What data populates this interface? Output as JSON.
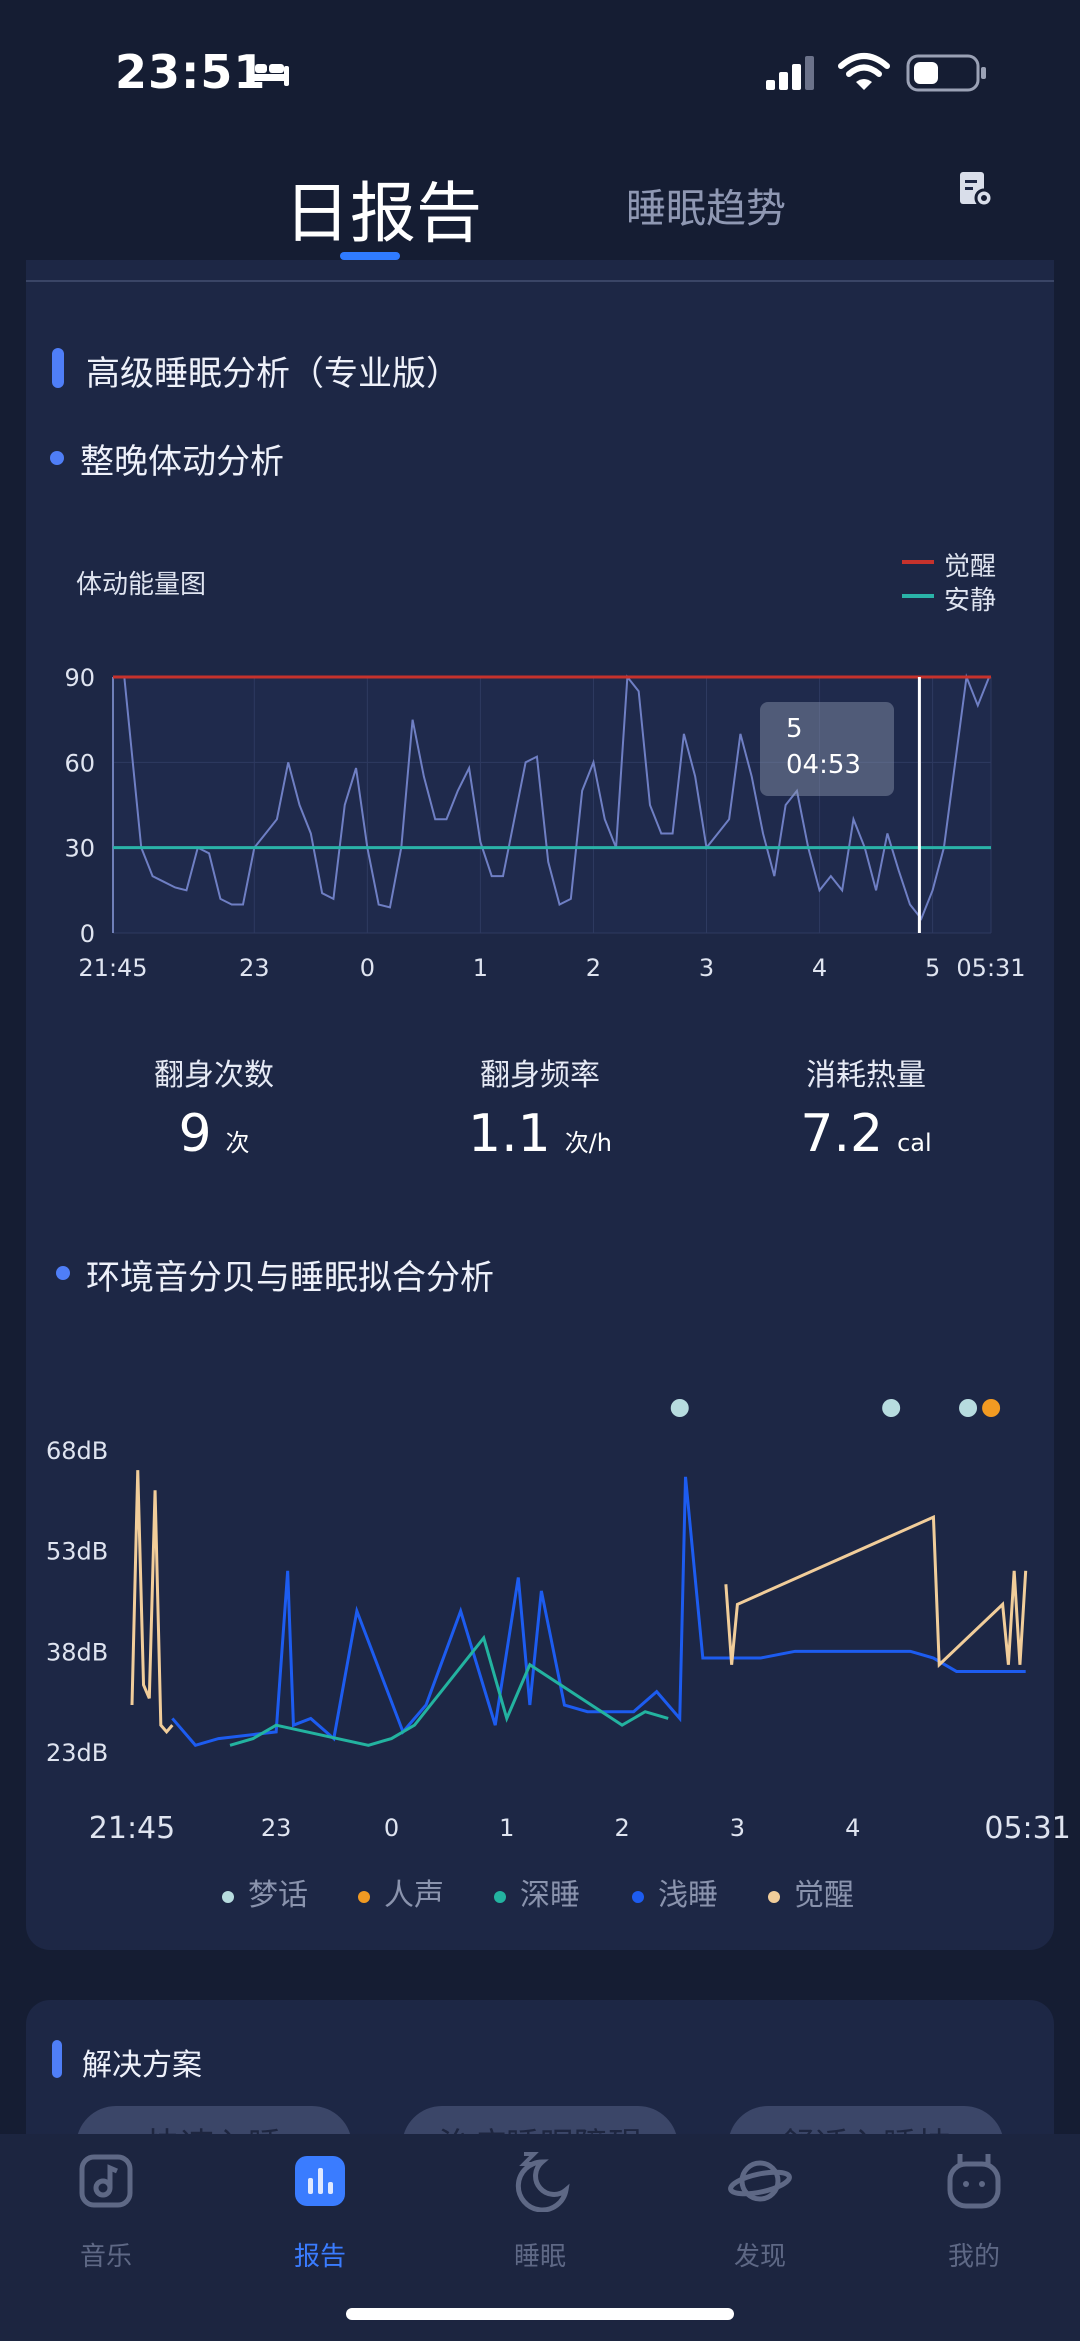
{
  "status_bar": {
    "time": "23:51"
  },
  "tabs": [
    {
      "label": "日报告"
    },
    {
      "label": "睡眠趋势"
    }
  ],
  "advanced": {
    "title": "高级睡眠分析（专业版）",
    "movement": {
      "title": "整晚体动分析",
      "chart_label": "体动能量图",
      "legend": [
        {
          "label": "觉醒",
          "color": "#c6322c"
        },
        {
          "label": "安静",
          "color": "#2ab3a8"
        }
      ],
      "tooltip": {
        "value": "5",
        "time": "04:53"
      }
    },
    "stats": [
      {
        "label": "翻身次数",
        "value": "9",
        "unit": "次"
      },
      {
        "label": "翻身频率",
        "value": "1.1",
        "unit": "次/h"
      },
      {
        "label": "消耗热量",
        "value": "7.2",
        "unit": "cal"
      }
    ],
    "sound": {
      "title": "环境音分贝与睡眠拟合分析",
      "legend": [
        {
          "label": "梦话",
          "color": "#b7dcdf"
        },
        {
          "label": "人声",
          "color": "#f19a22"
        },
        {
          "label": "深睡",
          "color": "#23b3a0"
        },
        {
          "label": "浅睡",
          "color": "#1d5cf0"
        },
        {
          "label": "觉醒",
          "color": "#f1cd9a"
        }
      ]
    }
  },
  "solutions": {
    "title": "解决方案",
    "items": [
      {
        "label": "快速入睡"
      },
      {
        "label": "治疗睡眠障碍"
      },
      {
        "label": "舒适入睡技"
      }
    ]
  },
  "nav": [
    {
      "label": "音乐",
      "icon": "music-icon"
    },
    {
      "label": "报告",
      "icon": "report-icon"
    },
    {
      "label": "睡眠",
      "icon": "sleep-moon-icon"
    },
    {
      "label": "发现",
      "icon": "planet-icon"
    },
    {
      "label": "我的",
      "icon": "profile-icon"
    }
  ],
  "colors": {
    "accent": "#2f7bff",
    "background": "#151d33",
    "card": "#1d2745"
  },
  "chart_data": [
    {
      "type": "line",
      "title": "体动能量图",
      "x_ticks": [
        "21:45",
        "23",
        "0",
        "1",
        "2",
        "3",
        "4",
        "5",
        "05:31"
      ],
      "y_ticks": [
        "0",
        "30",
        "60",
        "90"
      ],
      "ylim": [
        0,
        90
      ],
      "x_start": "21:45",
      "x_end": "05:31",
      "thresholds": [
        {
          "name": "觉醒",
          "value": 90
        },
        {
          "name": "安静",
          "value": 30
        }
      ],
      "cursor": {
        "time": "04:53",
        "value": 5
      },
      "series": [
        {
          "x_hours": [
            21.75,
            21.85,
            22.0,
            22.1,
            22.2,
            22.3,
            22.4,
            22.5,
            22.6,
            22.7,
            22.8,
            22.9,
            23.0,
            23.1,
            23.2,
            23.3,
            23.4,
            23.5,
            23.6,
            23.7,
            23.8,
            23.9,
            24.0,
            24.1,
            24.2,
            24.3,
            24.4,
            24.5,
            24.6,
            24.7,
            24.8,
            24.9,
            25.0,
            25.1,
            25.2,
            25.3,
            25.4,
            25.5,
            25.6,
            25.7,
            25.8,
            25.9,
            26.0,
            26.1,
            26.2,
            26.3,
            26.4,
            26.5,
            26.6,
            26.7,
            26.8,
            26.9,
            27.0,
            27.1,
            27.2,
            27.3,
            27.4,
            27.5,
            27.6,
            27.7,
            27.8,
            27.9,
            28.0,
            28.1,
            28.2,
            28.3,
            28.4,
            28.5,
            28.6,
            28.7,
            28.8,
            28.9,
            29.0,
            29.1,
            29.2,
            29.3,
            29.4,
            29.5
          ],
          "y": [
            90,
            90,
            30,
            20,
            18,
            16,
            15,
            30,
            28,
            12,
            10,
            10,
            30,
            35,
            40,
            60,
            45,
            35,
            14,
            12,
            45,
            58,
            30,
            10,
            9,
            30,
            75,
            55,
            40,
            40,
            50,
            58,
            32,
            20,
            20,
            40,
            60,
            62,
            25,
            10,
            12,
            50,
            60,
            40,
            30,
            90,
            85,
            45,
            35,
            35,
            70,
            55,
            30,
            35,
            40,
            70,
            55,
            35,
            20,
            45,
            50,
            30,
            15,
            20,
            15,
            40,
            30,
            15,
            35,
            22,
            10,
            5,
            15,
            30,
            60,
            90,
            80,
            90
          ]
        }
      ]
    },
    {
      "type": "line",
      "title": "环境音分贝与睡眠拟合分析",
      "y_ticks": [
        "23dB",
        "38dB",
        "53dB",
        "68dB"
      ],
      "ylim": [
        23,
        68
      ],
      "x_ticks": [
        "21:45",
        "23",
        "0",
        "1",
        "2",
        "3",
        "4",
        "05:31"
      ],
      "event_markers": [
        {
          "time": "02:30",
          "type": "梦话"
        },
        {
          "time": "04:20",
          "type": "梦话"
        },
        {
          "time": "05:00",
          "type": "梦话"
        },
        {
          "time": "05:12",
          "type": "人声"
        }
      ],
      "series": [
        {
          "name": "觉醒",
          "x_hours": [
            21.75,
            21.8,
            21.85,
            21.9,
            21.95,
            22.0,
            22.05,
            22.1
          ],
          "y": [
            30,
            65,
            33,
            31,
            62,
            27,
            26,
            27
          ]
        },
        {
          "name": "浅睡",
          "x_hours": [
            22.1,
            22.3,
            22.5,
            23.0,
            23.1,
            23.15,
            23.3,
            23.5,
            23.7,
            24.1,
            24.3,
            24.6,
            24.9,
            25.1,
            25.2,
            25.3,
            25.5,
            25.7,
            25.9,
            26.1,
            26.3,
            26.5,
            26.55,
            26.7,
            27.0,
            27.2,
            27.5,
            27.8,
            28.0,
            28.3,
            28.5,
            28.7,
            28.9,
            29.1,
            29.3,
            29.5
          ],
          "y": [
            28,
            24,
            25,
            26,
            50,
            27,
            28,
            25,
            44,
            26,
            30,
            44,
            27,
            49,
            30,
            47,
            30,
            29,
            29,
            29,
            32,
            28,
            64,
            37,
            37,
            37,
            38,
            38,
            38,
            38,
            38,
            37,
            35,
            35,
            35,
            35
          ]
        },
        {
          "name": "深睡",
          "x_hours": [
            22.6,
            22.8,
            23.0,
            23.8,
            24.0,
            24.2,
            24.8,
            25.0,
            25.2,
            26.0,
            26.2,
            26.4
          ],
          "y": [
            24,
            25,
            27,
            24,
            25,
            27,
            40,
            28,
            36,
            27,
            29,
            28
          ]
        },
        {
          "name": "觉醒",
          "x_hours": [
            26.9,
            26.95,
            27.0,
            28.7,
            28.75,
            29.3,
            29.35,
            29.4,
            29.45,
            29.5
          ],
          "y": [
            48,
            36,
            45,
            58,
            36,
            45,
            36,
            50,
            36,
            50
          ]
        }
      ]
    }
  ]
}
